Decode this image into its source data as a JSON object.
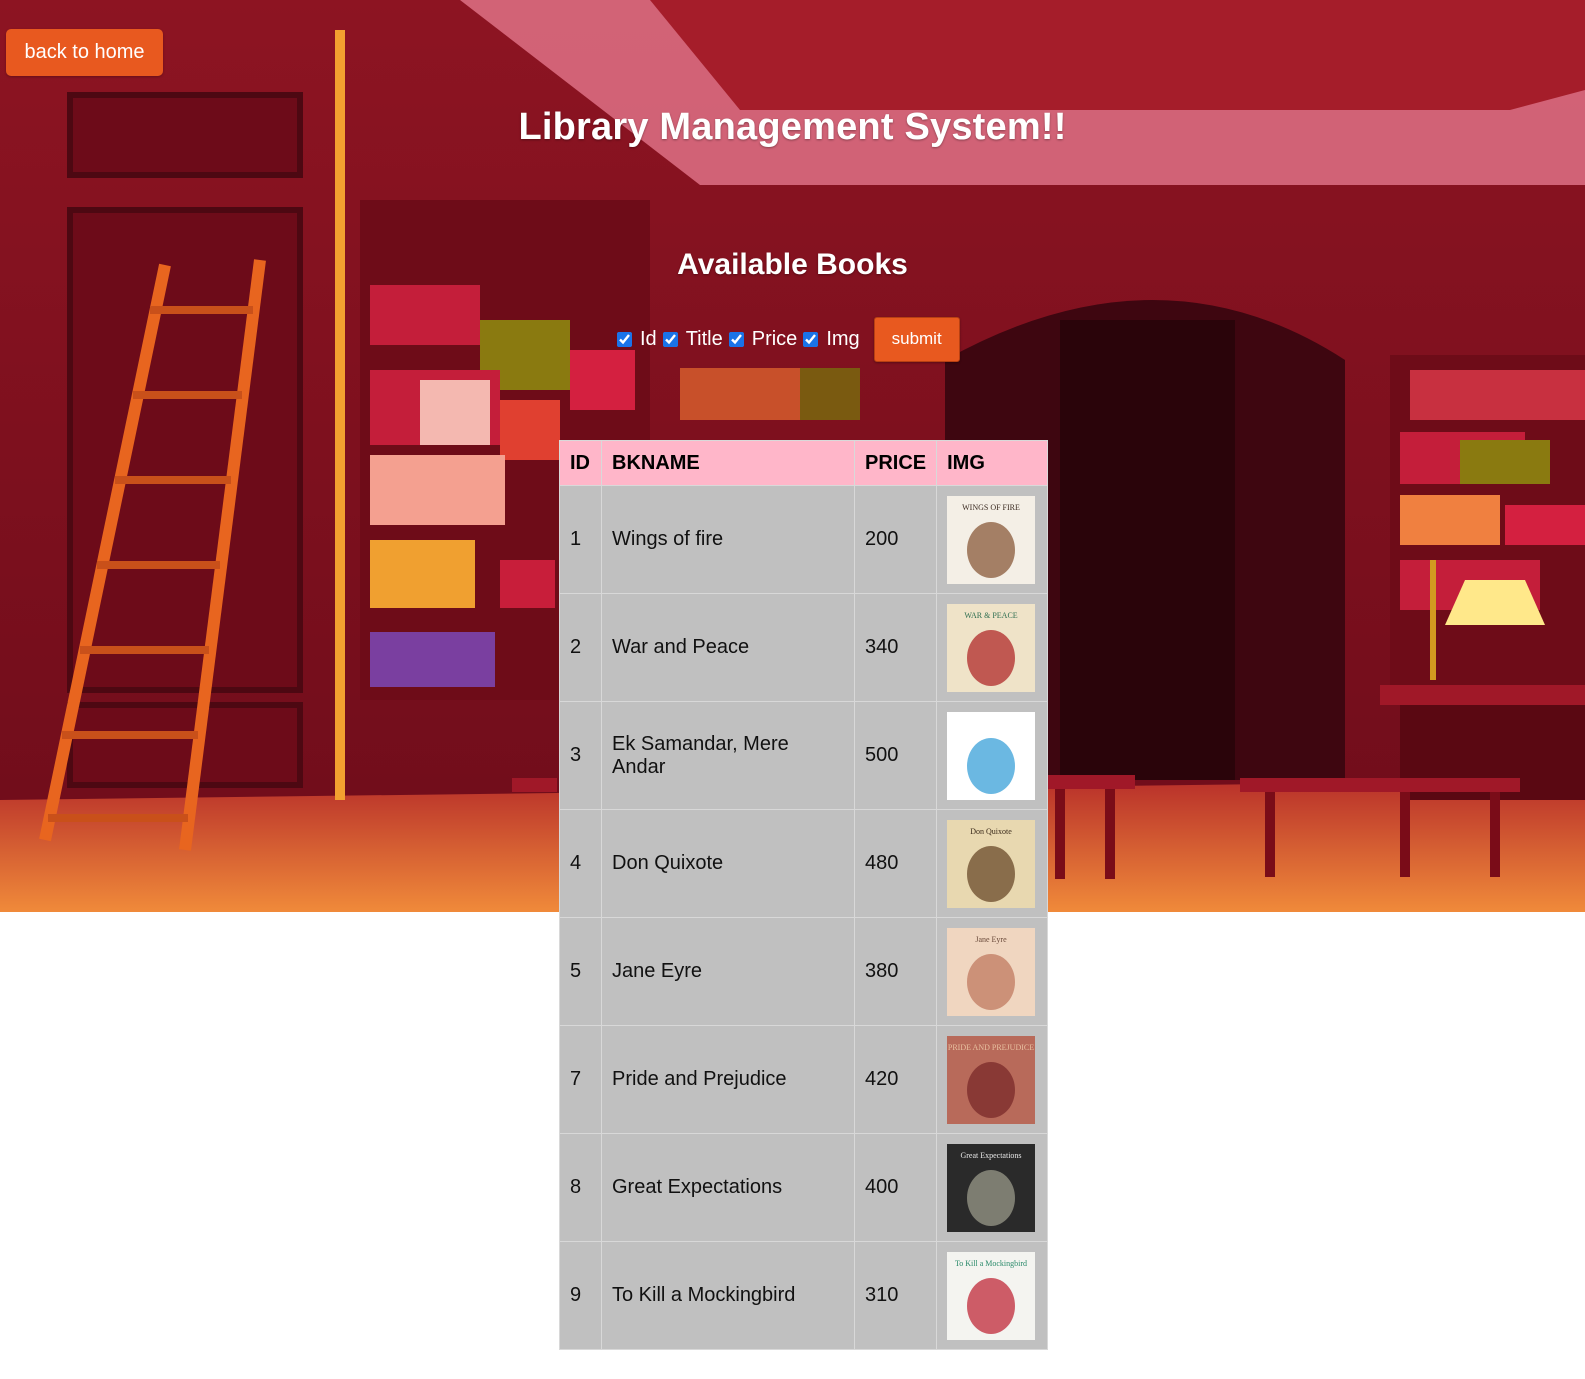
{
  "header": {
    "back_label": "back to home",
    "title": "Library Management System!!",
    "subtitle": "Available Books"
  },
  "filters": {
    "options": [
      {
        "label": "Id",
        "checked": true
      },
      {
        "label": "Title",
        "checked": true
      },
      {
        "label": "Price",
        "checked": true
      },
      {
        "label": "Img",
        "checked": true
      }
    ],
    "submit_label": "submit"
  },
  "table": {
    "columns": [
      "ID",
      "BKNAME",
      "PRICE",
      "IMG"
    ],
    "rows": [
      {
        "id": "1",
        "name": "Wings of fire",
        "price": "200",
        "cover": "book-cover-wings-of-fire",
        "cover_text": "WINGS OF FIRE"
      },
      {
        "id": "2",
        "name": "War and Peace",
        "price": "340",
        "cover": "book-cover-war-and-peace",
        "cover_text": "WAR & PEACE"
      },
      {
        "id": "3",
        "name": "Ek Samandar, Mere Andar",
        "price": "500",
        "cover": "book-cover-ek-samandar",
        "cover_text": ""
      },
      {
        "id": "4",
        "name": "Don Quixote",
        "price": "480",
        "cover": "book-cover-don-quixote",
        "cover_text": "Don Quixote"
      },
      {
        "id": "5",
        "name": "Jane Eyre",
        "price": "380",
        "cover": "book-cover-jane-eyre",
        "cover_text": "Jane Eyre"
      },
      {
        "id": "7",
        "name": "Pride and Prejudice",
        "price": "420",
        "cover": "book-cover-pride-and-prejudice",
        "cover_text": "PRIDE AND PREJUDICE"
      },
      {
        "id": "8",
        "name": "Great Expectations",
        "price": "400",
        "cover": "book-cover-great-expectations",
        "cover_text": "Great Expectations"
      },
      {
        "id": "9",
        "name": "To Kill a Mockingbird",
        "price": "310",
        "cover": "book-cover-to-kill-a-mockingbird",
        "cover_text": "To Kill a Mockingbird"
      }
    ]
  },
  "colors": {
    "accent": "#e8591f",
    "header_row": "#ffb6c9",
    "cell_bg": "#c0c0c0"
  }
}
